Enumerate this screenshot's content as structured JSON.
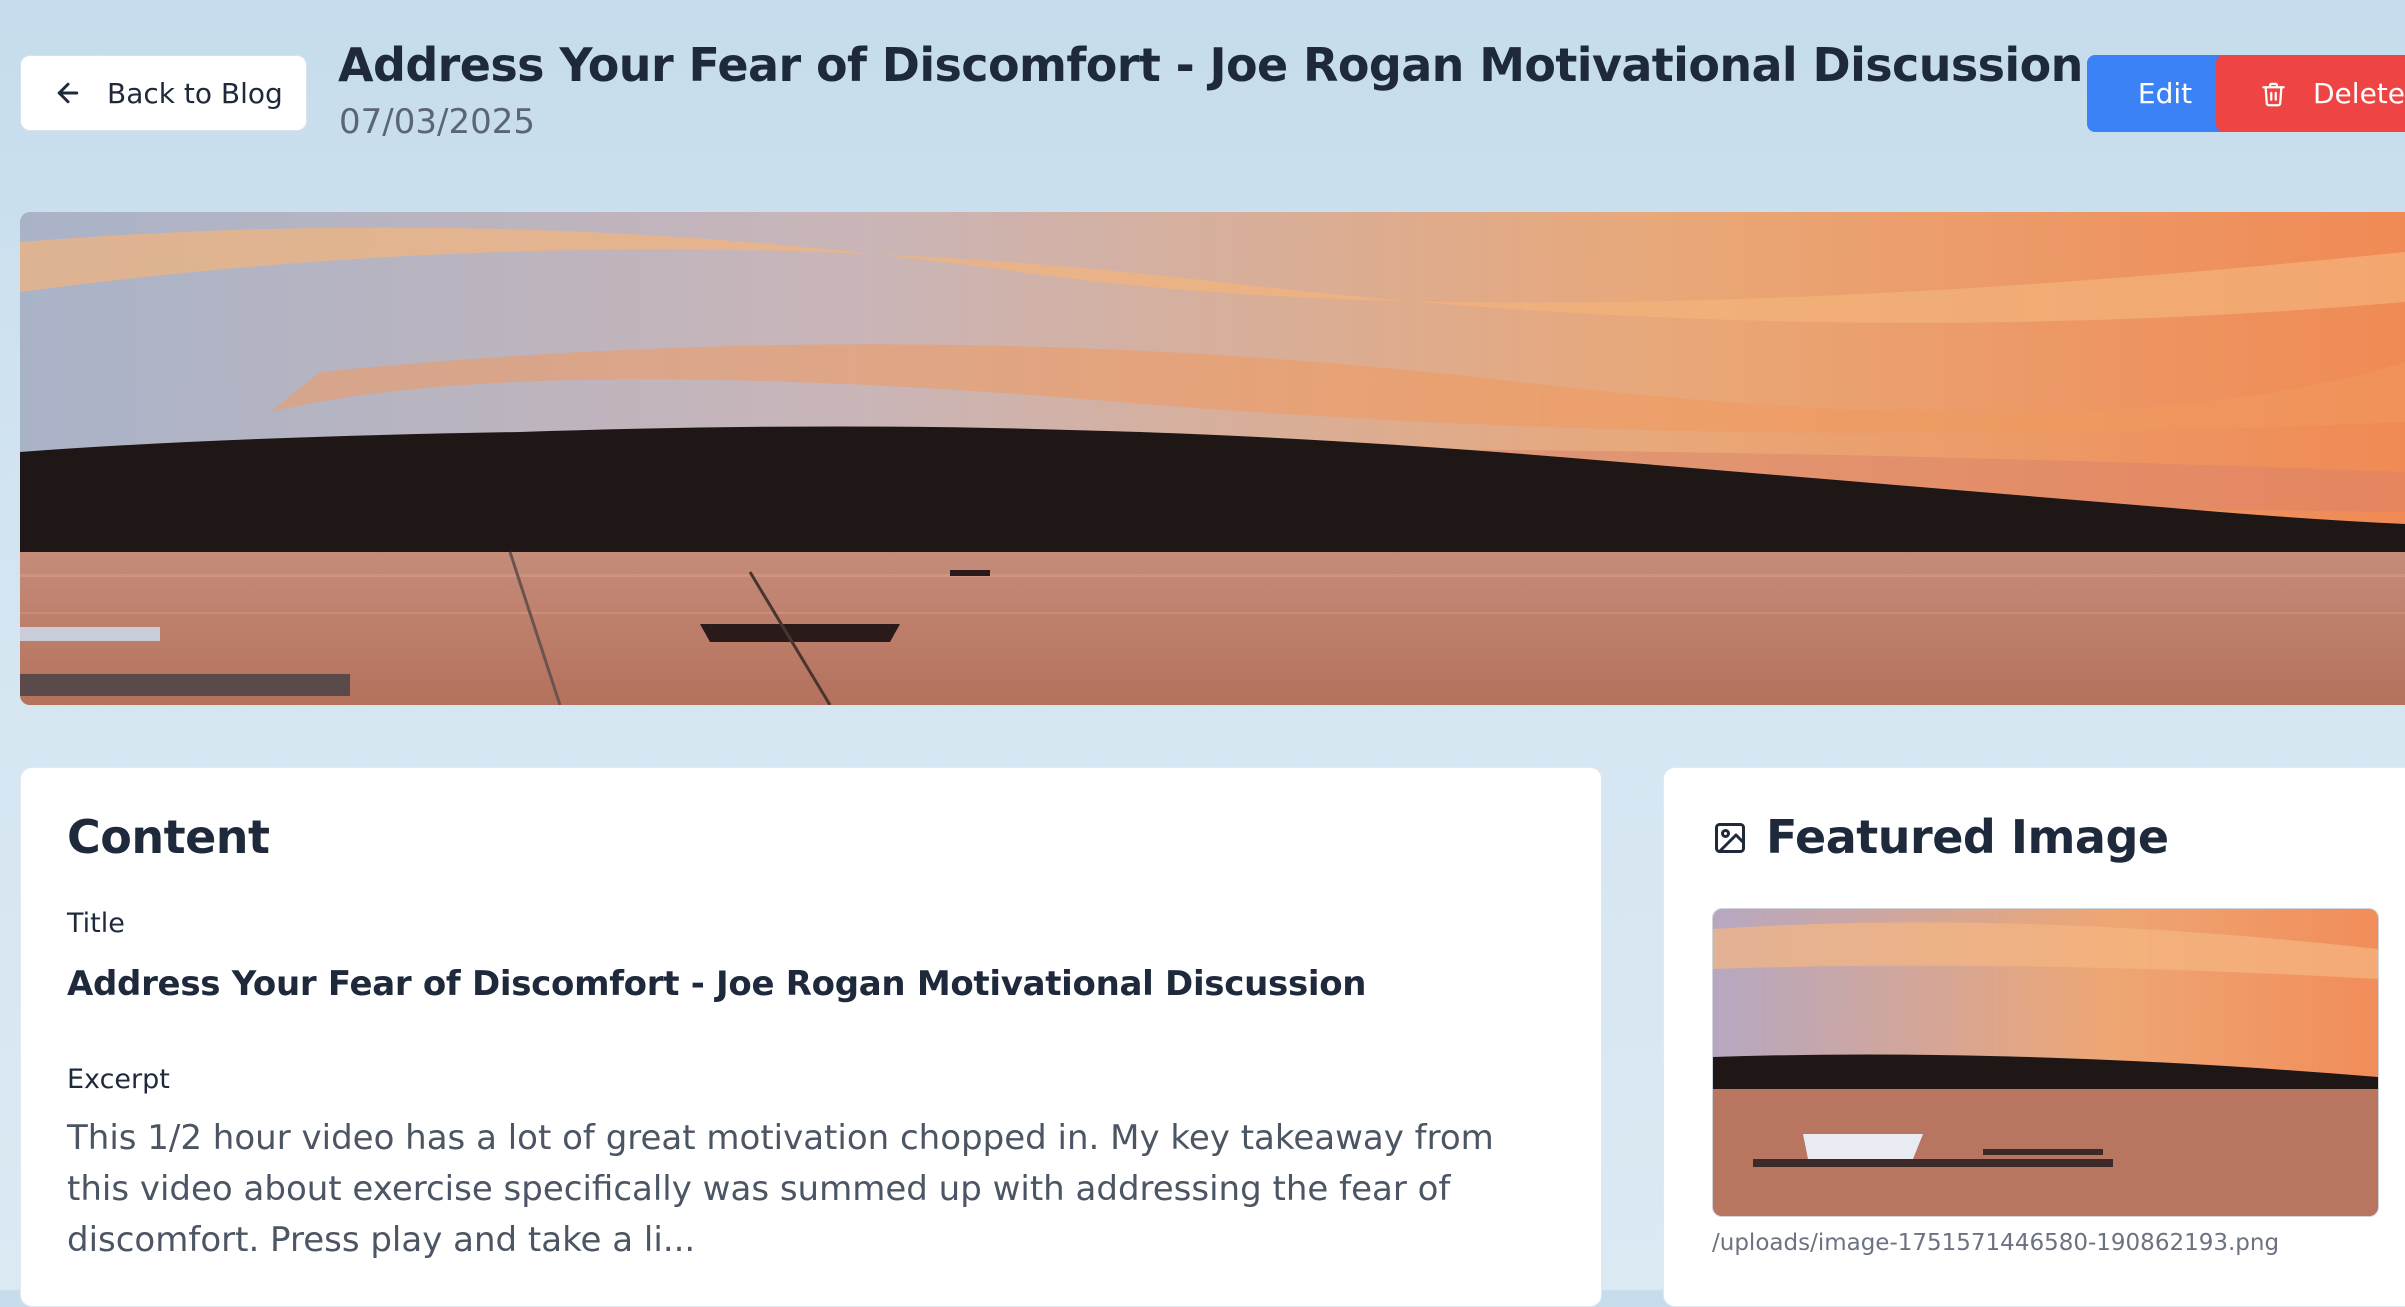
{
  "header": {
    "back_label": "Back to Blog",
    "title": "Address Your Fear of Discomfort - Joe Rogan Motivational Discussion",
    "date": "07/03/2025",
    "edit_label": "Edit",
    "delete_label": "Delete"
  },
  "content": {
    "heading": "Content",
    "title_label": "Title",
    "title_value": "Address Your Fear of Discomfort - Joe Rogan Motivational Discussion",
    "excerpt_label": "Excerpt",
    "excerpt_value": "This 1/2 hour video has a lot of great motivation chopped in. My key takeaway from this video about exercise specifically was summed up with addressing the fear of discomfort. Press play and take a li..."
  },
  "featured": {
    "heading": "Featured Image",
    "path": "/uploads/image-1751571446580-190862193.png"
  },
  "icons": {
    "back": "arrow-left-icon",
    "delete": "trash-icon",
    "featured": "image-icon"
  },
  "colors": {
    "edit": "#3b82f6",
    "delete": "#ef4444",
    "text": "#1e293b"
  }
}
